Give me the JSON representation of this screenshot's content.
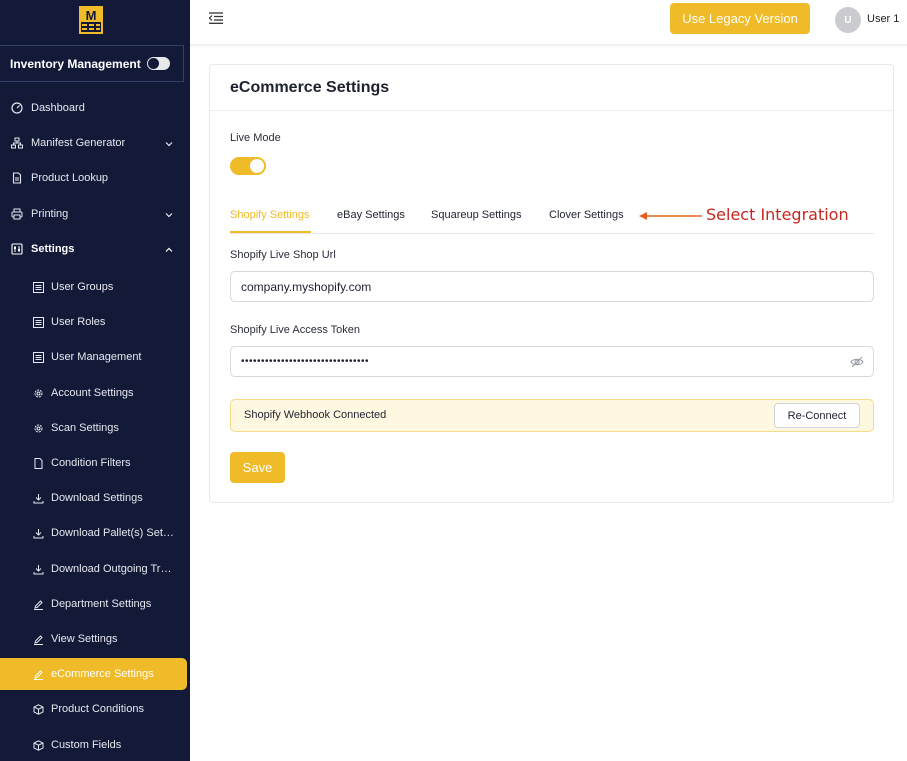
{
  "sidebar": {
    "logo_text": "M",
    "inventory_label": "Inventory Management",
    "top_items": [
      {
        "label": "Dashboard",
        "icon": "dashboard-icon"
      },
      {
        "label": "Manifest Generator",
        "icon": "sitemap-icon"
      },
      {
        "label": "Product Lookup",
        "icon": "file-icon"
      },
      {
        "label": "Printing",
        "icon": "printer-icon"
      },
      {
        "label": "Settings",
        "icon": "sliders-icon"
      }
    ],
    "sub_items": [
      {
        "label": "User Groups",
        "icon": "list-icon"
      },
      {
        "label": "User Roles",
        "icon": "list-icon"
      },
      {
        "label": "User Management",
        "icon": "list-icon"
      },
      {
        "label": "Account Settings",
        "icon": "gear-icon"
      },
      {
        "label": "Scan Settings",
        "icon": "gear-icon"
      },
      {
        "label": "Condition Filters",
        "icon": "file-icon"
      },
      {
        "label": "Download Settings",
        "icon": "download-icon"
      },
      {
        "label": "Download Pallet(s) Settings",
        "icon": "download-icon"
      },
      {
        "label": "Download Outgoing Truck Settings",
        "icon": "download-icon"
      },
      {
        "label": "Department Settings",
        "icon": "pencil-icon"
      },
      {
        "label": "View Settings",
        "icon": "pencil-icon"
      },
      {
        "label": "eCommerce Settings",
        "icon": "pencil-icon"
      },
      {
        "label": "Product Conditions",
        "icon": "cube-icon"
      },
      {
        "label": "Custom Fields",
        "icon": "cube-icon"
      }
    ]
  },
  "header": {
    "legacy_button": "Use Legacy Version",
    "avatar_initial": "U",
    "user_name": "User 1"
  },
  "main": {
    "title": "eCommerce Settings",
    "live_mode_label": "Live Mode",
    "live_mode_on": true,
    "tabs": [
      {
        "label": "Shopify Settings",
        "active": true
      },
      {
        "label": "eBay Settings",
        "active": false
      },
      {
        "label": "Squareup Settings",
        "active": false
      },
      {
        "label": "Clover Settings",
        "active": false
      }
    ],
    "annotation": "Select Integration",
    "shop_url_label": "Shopify Live Shop Url",
    "shop_url_value": "company.myshopify.com",
    "token_label": "Shopify Live Access Token",
    "token_value": "••••••••••••••••••••••••••••••••",
    "webhook_status": "Shopify Webhook Connected",
    "reconnect_button": "Re-Connect",
    "save_button": "Save"
  },
  "colors": {
    "sidebar_bg": "#121a38",
    "accent": "#f0bb28",
    "annotation": "#c7261e",
    "webhook_bg": "#fff8e1"
  }
}
